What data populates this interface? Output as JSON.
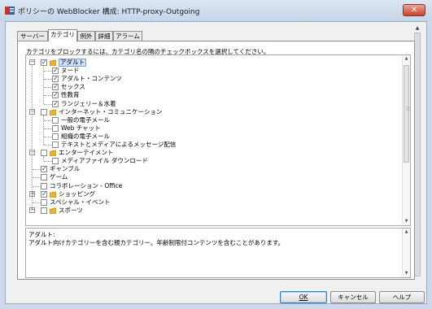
{
  "window": {
    "title": "ポリシーの WebBlocker 構成: HTTP-proxy-Outgoing",
    "close_label": "✕"
  },
  "tabs": [
    {
      "label": "サーバー",
      "active": false
    },
    {
      "label": "カテゴリ",
      "active": true
    },
    {
      "label": "例外",
      "active": false
    },
    {
      "label": "詳細",
      "active": false
    },
    {
      "label": "アラーム",
      "active": false
    }
  ],
  "instruction": "カテゴリをブロックするには、カテゴリ名の隣のチェックボックスを選択してください。",
  "tree": [
    {
      "label": "アダルト",
      "level": 0,
      "checked": true,
      "folder": true,
      "expander": "−",
      "selected": true
    },
    {
      "label": "ヌード",
      "level": 1,
      "checked": true
    },
    {
      "label": "アダルト・コンテンツ",
      "level": 1,
      "checked": true
    },
    {
      "label": "セックス",
      "level": 1,
      "checked": true
    },
    {
      "label": "性教育",
      "level": 1,
      "checked": true
    },
    {
      "label": "ランジェリー＆水着",
      "level": 1,
      "checked": true
    },
    {
      "label": "インターネット・コミュニケーション",
      "level": 0,
      "checked": false,
      "folder": true,
      "expander": "−"
    },
    {
      "label": "一般の電子メール",
      "level": 1,
      "checked": false
    },
    {
      "label": "Web チャット",
      "level": 1,
      "checked": false
    },
    {
      "label": "組織の電子メール",
      "level": 1,
      "checked": false
    },
    {
      "label": "テキストとメディアによるメッセージ配信",
      "level": 1,
      "checked": false
    },
    {
      "label": "エンターテイメント",
      "level": 0,
      "checked": false,
      "folder": true,
      "expander": "−"
    },
    {
      "label": "メディアファイル ダウンロード",
      "level": 1,
      "checked": false
    },
    {
      "label": "ギャンブル",
      "level": 0,
      "checked": true
    },
    {
      "label": "ゲーム",
      "level": 0,
      "checked": false
    },
    {
      "label": "コラボレーション - Office",
      "level": 0,
      "checked": false
    },
    {
      "label": "ショッピング",
      "level": 0,
      "checked": true,
      "folder": true,
      "expander": "+"
    },
    {
      "label": "スペシャル・イベント",
      "level": 0,
      "checked": false
    },
    {
      "label": "スポーツ",
      "level": 0,
      "checked": false,
      "folder": true,
      "expander": "−"
    }
  ],
  "description": {
    "title": "アダルト:",
    "text": "アダルト向けカテゴリーを含む親カテゴリー。年齢制限付コンテンツを含むことがあります。"
  },
  "buttons": {
    "ok": "OK",
    "cancel": "キャンセル",
    "help": "ヘルプ"
  },
  "colors": {
    "folder": "#e8b32a",
    "selection": "#cfe0fa",
    "titlebar": "#c6d5e9"
  }
}
